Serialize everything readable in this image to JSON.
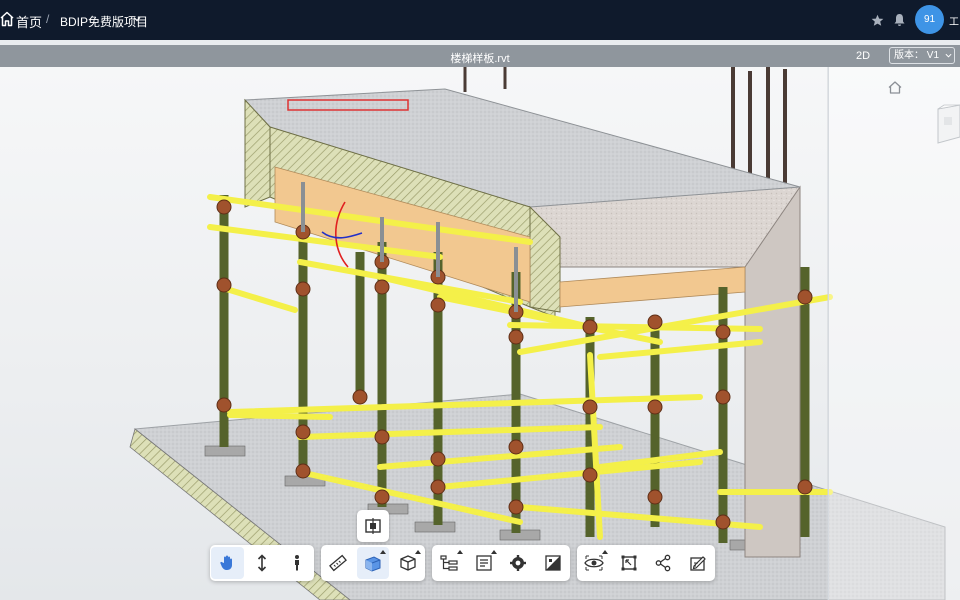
{
  "header": {
    "home_label": "首页",
    "separator": "/",
    "project_name": "BDIP免费版项目",
    "avatar_text": "91",
    "user_name": "工"
  },
  "filebar": {
    "file_name": "楼梯样板.rvt",
    "view_mode": "2D",
    "version_label": "版本：",
    "version_value": "V1"
  },
  "icons": {
    "home": "home-icon",
    "project_dropdown": "chevron-down-icon",
    "favorite": "star-icon",
    "notifications": "bell-icon",
    "section": "section-box-icon",
    "pan": "hand-icon",
    "fly": "vertical-arrow-icon",
    "walk": "person-icon",
    "measure": "ruler-icon",
    "section_cube": "section-cube-icon",
    "explode": "cube-icon",
    "tree": "model-tree-icon",
    "properties": "properties-icon",
    "settings": "settings-icon",
    "materials": "material-icon",
    "hide": "eye-icon",
    "fullscreen": "frame-icon",
    "share": "share-icon",
    "annotate": "annotate-icon"
  },
  "colors": {
    "topbar": "#0f1a2c",
    "avatar": "#3e94e6",
    "filebar": "#8f969d",
    "active_tool": "#3a78d8"
  }
}
